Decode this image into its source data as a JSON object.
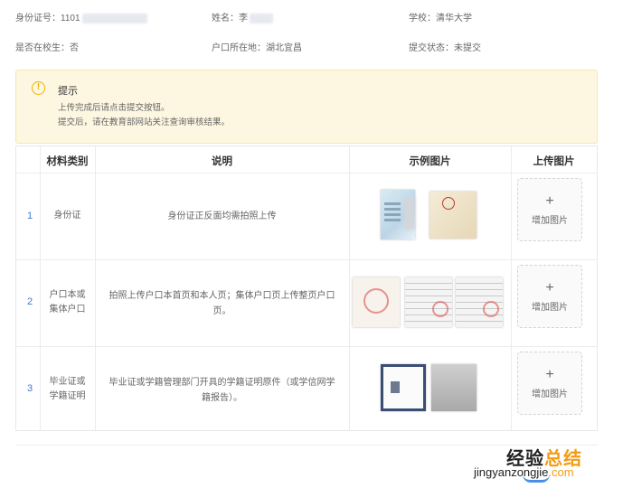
{
  "info": {
    "id_label": "身份证号：1101",
    "name_label": "姓名：李",
    "school_label": "学校：清华大学",
    "enrolled_label": "是否在校生：否",
    "hukou_label": "户口所在地：湖北宜昌",
    "status_label": "提交状态：未提交"
  },
  "notice": {
    "title": "提示",
    "line1": "上传完成后请点击提交按钮。",
    "line2": "提交后，请在教育部网站关注查询审核结果。",
    "icon_char": "!"
  },
  "table": {
    "headers": [
      "材料类别",
      "说明",
      "示例图片",
      "上传图片"
    ],
    "rows": [
      {
        "index": "1",
        "category_line1": "身份证",
        "category_line2": "",
        "desc_line1": "身份证正反面均需拍照上传",
        "desc_line2": "",
        "upload_plus": "+",
        "upload_label": "增加图片"
      },
      {
        "index": "2",
        "category_line1": "户口本或",
        "category_line2": "集体户口",
        "desc_line1": "拍照上传户口本首页和本人页；集体户口页上传整页户口",
        "desc_line2": "页。",
        "upload_plus": "+",
        "upload_label": "增加图片"
      },
      {
        "index": "3",
        "category_line1": "毕业证或",
        "category_line2": "学籍证明",
        "desc_line1": "毕业证或学籍管理部门开具的学籍证明原件（或学信网学",
        "desc_line2": "籍报告）。",
        "upload_plus": "+",
        "upload_label": "增加图片"
      }
    ]
  },
  "watermark": {
    "cn_black": "经验",
    "cn_orange": "总结",
    "en_black": "jingyanzongjie",
    "en_orange": ".com"
  }
}
